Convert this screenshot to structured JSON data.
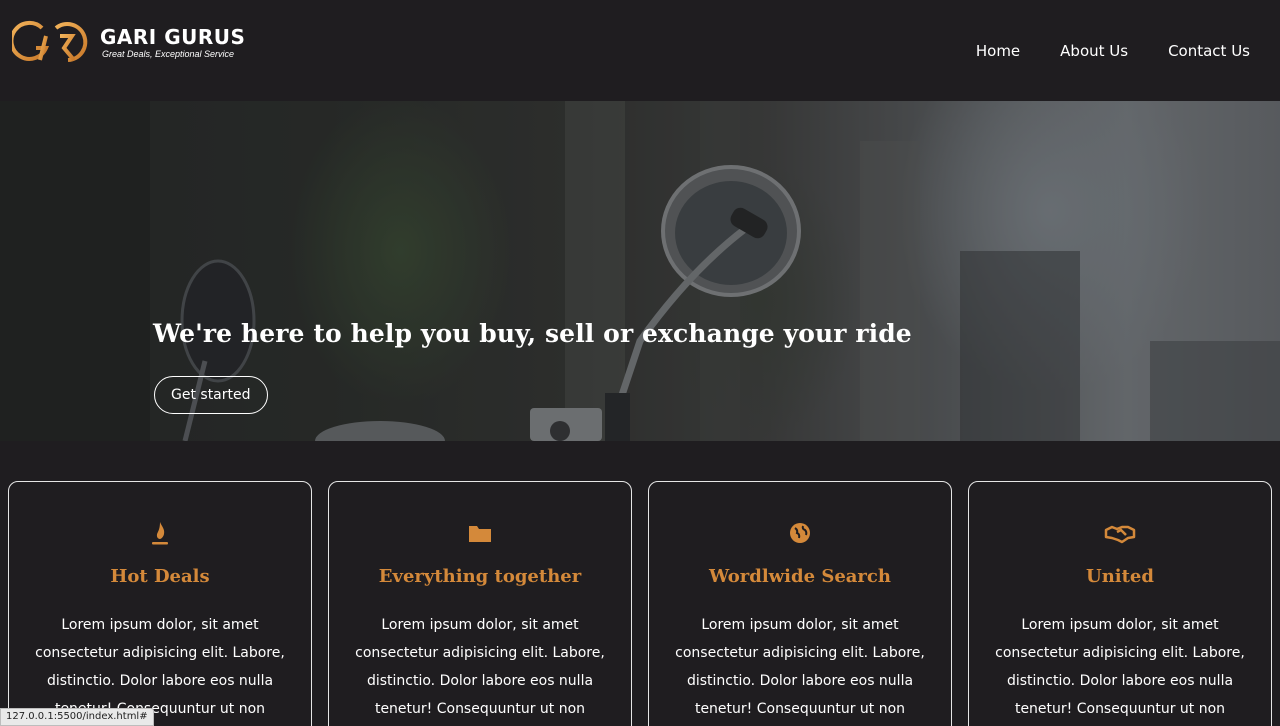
{
  "brand": {
    "name": "GARI GURUS",
    "tagline": "Great Deals, Exceptional Service",
    "accent_color": "#d4893a"
  },
  "nav": {
    "items": [
      {
        "label": "Home"
      },
      {
        "label": "About Us"
      },
      {
        "label": "Contact Us"
      }
    ]
  },
  "hero": {
    "title": "We're here to help you buy, sell or exchange your ride",
    "button_label": "Get started"
  },
  "cards": [
    {
      "icon": "fire-icon",
      "title": "Hot Deals",
      "text": "Lorem ipsum dolor, sit amet consectetur adipisicing elit. Labore, distinctio. Dolor labore eos nulla tenetur! Consequuntur ut non animi"
    },
    {
      "icon": "folder-icon",
      "title": "Everything together",
      "text": "Lorem ipsum dolor, sit amet consectetur adipisicing elit. Labore, distinctio. Dolor labore eos nulla tenetur! Consequuntur ut non animi"
    },
    {
      "icon": "globe-icon",
      "title": "Wordlwide Search",
      "text": "Lorem ipsum dolor, sit amet consectetur adipisicing elit. Labore, distinctio. Dolor labore eos nulla tenetur! Consequuntur ut non animi"
    },
    {
      "icon": "handshake-icon",
      "title": "United",
      "text": "Lorem ipsum dolor, sit amet consectetur adipisicing elit. Labore, distinctio. Dolor labore eos nulla tenetur! Consequuntur ut non animi"
    }
  ],
  "status_bar": {
    "url": "127.0.0.1:5500/index.html#"
  }
}
